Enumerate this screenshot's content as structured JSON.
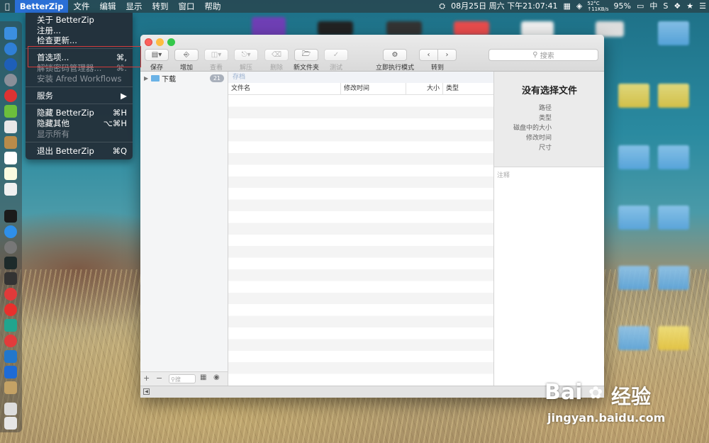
{
  "menubar": {
    "apple": "",
    "app_name": "BetterZip",
    "items": [
      "文件",
      "编辑",
      "显示",
      "转到",
      "窗口",
      "帮助"
    ],
    "right": {
      "datetime": "08月25日 周六 下午21:07:41",
      "temp": "52°C",
      "net_up": "↑11KB/s",
      "battery": "95%",
      "input": "中"
    }
  },
  "app_menu": {
    "about": "关于 BetterZip",
    "register": "注册...",
    "check_updates": "检查更新...",
    "preferences": "首选项...",
    "preferences_shortcut": "⌘,",
    "password_manager": "解锁密码管理器...",
    "password_manager_shortcut": "⌘.",
    "install_alfred": "安装 Afred Workflows",
    "services": "服务",
    "services_arrow": "▶",
    "hide_app": "隐藏 BetterZip",
    "hide_app_shortcut": "⌘H",
    "hide_others": "隐藏其他",
    "hide_others_shortcut": "⌥⌘H",
    "show_all": "显示所有",
    "quit": "退出 BetterZip",
    "quit_shortcut": "⌘Q"
  },
  "toolbar": {
    "save": "保存",
    "add": "增加",
    "view": "查看",
    "extract": "解压",
    "delete": "删除",
    "new_folder": "新文件夹",
    "test": "测试",
    "instant_mode": "立即执行模式",
    "goto": "转到",
    "search_placeholder": "搜索"
  },
  "sidebar": {
    "items": [
      {
        "label": "下载",
        "count": "21"
      }
    ]
  },
  "content": {
    "archive_label": "存档",
    "columns": [
      "文件名",
      "修改时间",
      "大小",
      "类型"
    ]
  },
  "info_panel": {
    "title": "没有选择文件",
    "labels": [
      "路径",
      "类型",
      "磁盘中的大小",
      "修改时间",
      "尺寸"
    ],
    "notes_placeholder": "注释"
  },
  "bottom_bar": {
    "add": "+",
    "remove": "−",
    "filter_placeholder": "搜"
  },
  "watermark": {
    "brand": "Bai",
    "brand2": "经验",
    "url": "jingyan.baidu.com"
  }
}
